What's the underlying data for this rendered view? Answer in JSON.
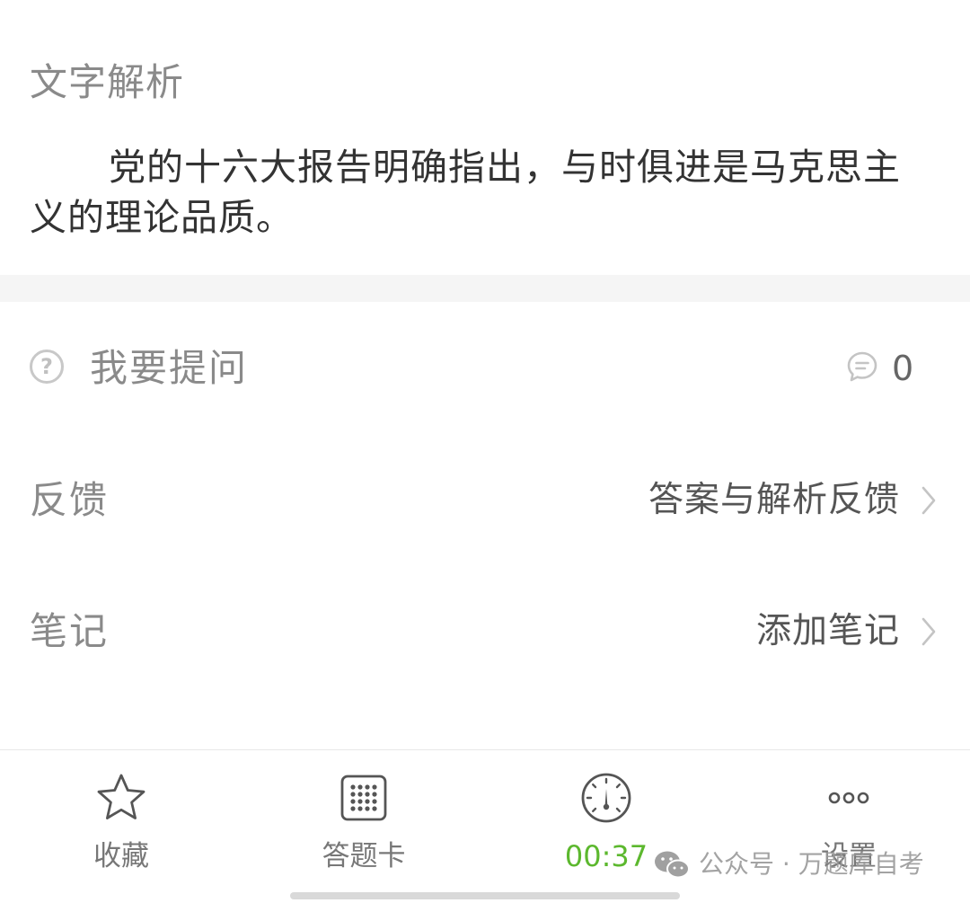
{
  "analysis": {
    "title": "文字解析",
    "text": "党的十六大报告明确指出，与时俱进是马克思主义的理论品质。"
  },
  "ask": {
    "label": "我要提问",
    "icon": "question-circle-icon",
    "comment_icon": "comment-bubble-icon",
    "comment_count": "0"
  },
  "feedback": {
    "label": "反馈",
    "action": "答案与解析反馈"
  },
  "notes": {
    "label": "笔记",
    "action": "添加笔记"
  },
  "tabbar": {
    "items": [
      {
        "label": "收藏",
        "icon": "star-icon"
      },
      {
        "label": "答题卡",
        "icon": "grid-icon"
      },
      {
        "label": "00:37",
        "icon": "speedometer-icon"
      },
      {
        "label": "设置",
        "icon": "more-dots-icon"
      }
    ]
  },
  "watermark": {
    "text": "公众号 · 万题库自考",
    "icon": "wechat-icon"
  },
  "colors": {
    "timer_green": "#5cb82e",
    "label_gray": "#8a8a8a",
    "text_dark": "#333333"
  }
}
